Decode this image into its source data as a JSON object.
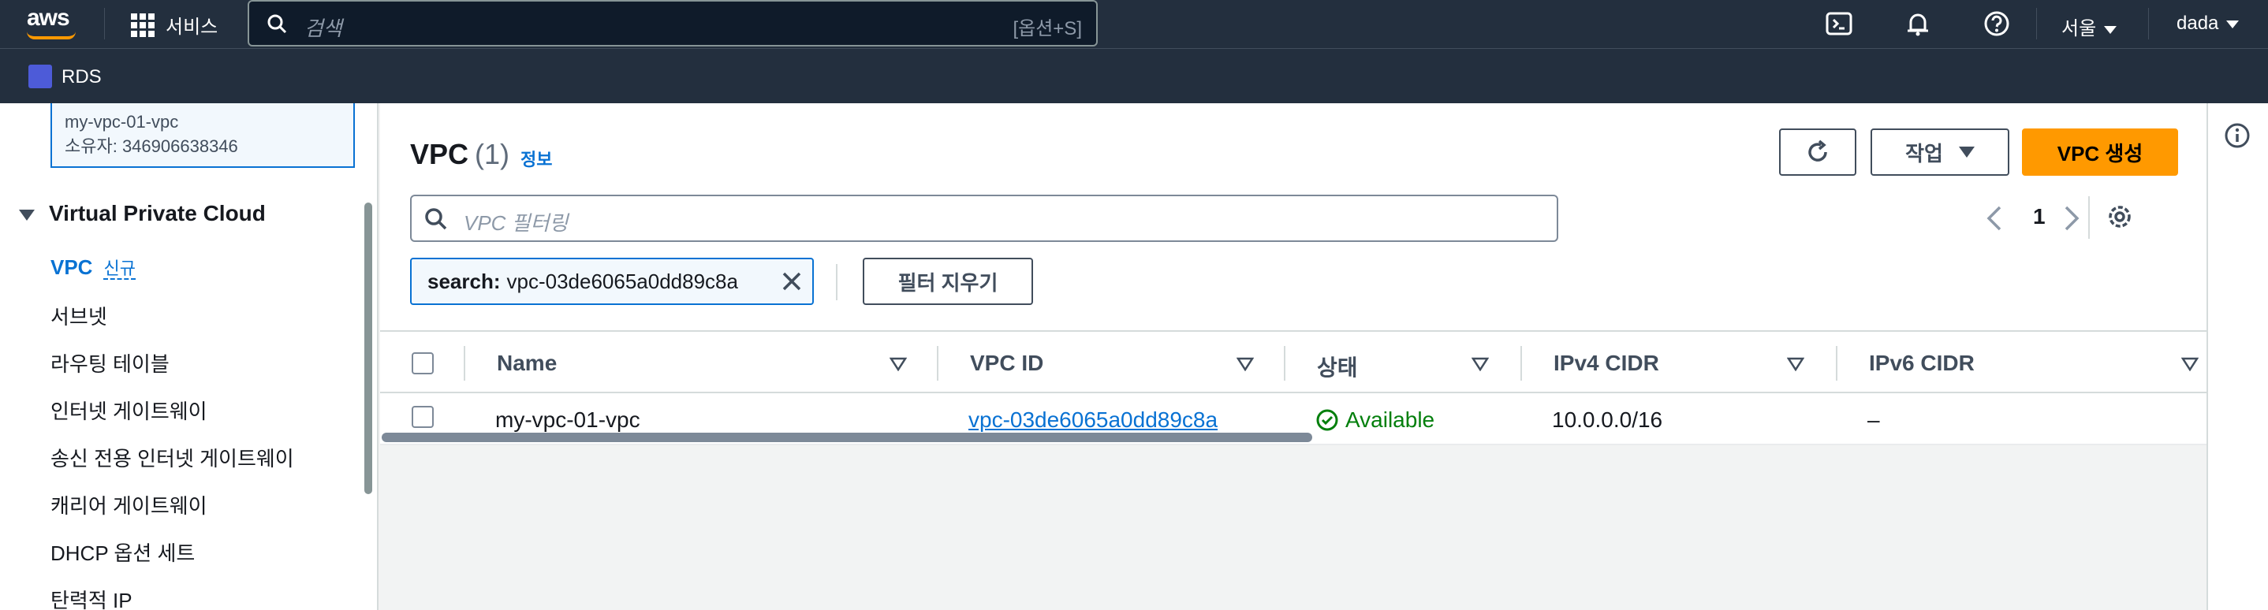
{
  "topnav": {
    "logo": "aws",
    "services_label": "서비스",
    "search_placeholder": "검색",
    "search_shortcut": "[옵션+S]",
    "region": "서울",
    "user": "dada",
    "icons": [
      "cloudshell-icon",
      "bell-icon",
      "help-icon"
    ]
  },
  "subbar": {
    "service": "RDS"
  },
  "sidebar": {
    "vpc_selector": {
      "name": "my-vpc-01-vpc",
      "owner": "소유자: 346906638346"
    },
    "section_title": "Virtual Private Cloud",
    "items": [
      {
        "label": "VPC",
        "badge": "신규",
        "active": true
      },
      {
        "label": "서브넷"
      },
      {
        "label": "라우팅 테이블"
      },
      {
        "label": "인터넷 게이트웨이"
      },
      {
        "label": "송신 전용 인터넷 게이트웨이"
      },
      {
        "label": "캐리어 게이트웨이"
      },
      {
        "label": "DHCP 옵션 세트"
      },
      {
        "label": "탄력적 IP"
      }
    ]
  },
  "main": {
    "title": "VPC",
    "count": "(1)",
    "info": "정보",
    "refresh_icon": "refresh-icon",
    "actions_label": "작업",
    "create_label": "VPC 생성",
    "filter_placeholder": "VPC 필터링",
    "page": "1",
    "token_key": "search:",
    "token_value": "vpc-03de6065a0dd89c8a",
    "clear_filters": "필터 지우기",
    "columns": [
      "Name",
      "VPC ID",
      "상태",
      "IPv4 CIDR",
      "IPv6 CIDR"
    ],
    "rows": [
      {
        "name": "my-vpc-01-vpc",
        "vpc_id": "vpc-03de6065a0dd89c8a",
        "status": "Available",
        "ipv4": "10.0.0.0/16",
        "ipv6": "–"
      }
    ]
  },
  "colors": {
    "nav_bg": "#232f3e",
    "primary": "#ff9900",
    "link": "#0972d3",
    "success": "#037f0c"
  }
}
